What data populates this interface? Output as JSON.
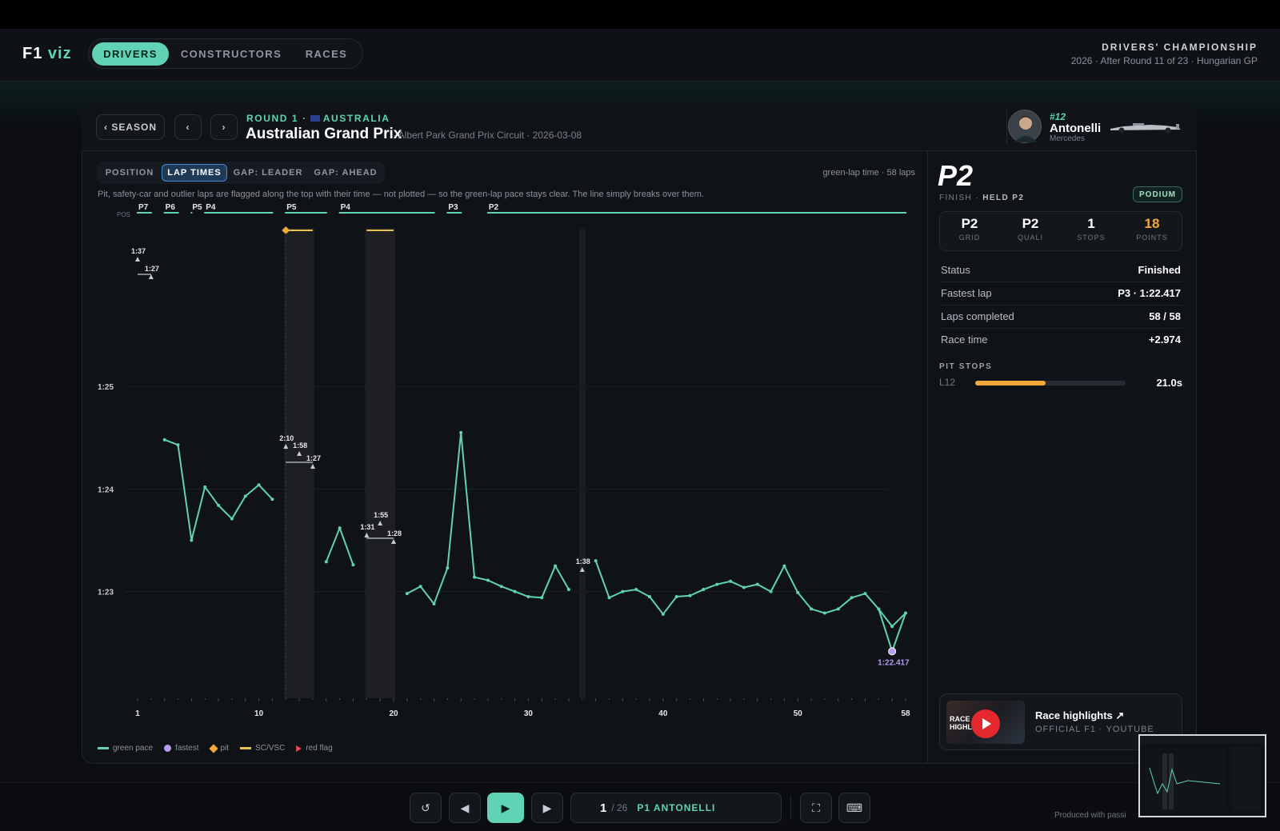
{
  "app": {
    "logo_a": "F1",
    "logo_b": "viz"
  },
  "nav": {
    "tabs": [
      "DRIVERS",
      "CONSTRUCTORS",
      "RACES"
    ],
    "active": "DRIVERS"
  },
  "championship": {
    "title": "DRIVERS' CHAMPIONSHIP",
    "subtitle": "2026 · After Round 11 of 23 · Hungarian GP"
  },
  "race": {
    "season_btn": "‹ SEASON",
    "prev": "‹",
    "next": "›",
    "round": "ROUND 1 ·",
    "country": "AUSTRALIA",
    "name": "Australian Grand Prix",
    "sub": "· Albert Park Grand Prix Circuit · 2026-03-08"
  },
  "driver": {
    "number": "#12",
    "name": "Antonelli",
    "team": "Mercedes"
  },
  "view_tabs": [
    "POSITION",
    "LAP TIMES",
    "GAP: LEADER",
    "GAP: AHEAD"
  ],
  "active_view": "LAP TIMES",
  "laps_info": "green-lap time · 58 laps",
  "note": "Pit, safety-car and outlier laps are flagged along the top with their time — not plotted — so the green-lap pace stays clear. The line simply breaks over them.",
  "legend": {
    "green": "green pace",
    "fastest": "fastest",
    "pit": "pit",
    "sc": "SC/VSC",
    "red": "red flag"
  },
  "result": {
    "position": "P2",
    "sub_a": "FINISH ·",
    "sub_b": "HELD P2",
    "badge": "PODIUM"
  },
  "stats": [
    {
      "value": "P2",
      "label": "GRID"
    },
    {
      "value": "P2",
      "label": "QUALI"
    },
    {
      "value": "1",
      "label": "STOPS"
    },
    {
      "value": "18",
      "label": "POINTS"
    }
  ],
  "points_color": "#f2a93b",
  "details": [
    {
      "k": "Status",
      "v": "Finished"
    },
    {
      "k": "Fastest lap",
      "v": "P3 · 1:22.417"
    },
    {
      "k": "Laps completed",
      "v": "58 / 58"
    },
    {
      "k": "Race time",
      "v": "+2.974"
    }
  ],
  "pit_stops": {
    "title": "PIT STOPS",
    "lap": "L12",
    "time": "21.0s",
    "bar_fraction": 0.47
  },
  "highlights": {
    "title": "Race highlights ↗",
    "sub": "OFFICIAL F1 · YOUTUBE",
    "thumb_text": "RACE HIGHLIGHTS"
  },
  "player": {
    "frame": "1",
    "total": "/ 26",
    "label": "P1 ANTONELLI"
  },
  "produced": "Produced with passi",
  "chart_data": {
    "type": "line",
    "xlabel": "",
    "ylabel": "",
    "x_ticks": [
      1,
      10,
      20,
      30,
      40,
      50,
      58
    ],
    "xlim": [
      1,
      58
    ],
    "y_ticks": [
      "1:25",
      "1:24",
      "1:23"
    ],
    "y_tick_seconds": [
      85,
      84,
      83
    ],
    "ylim_seconds": [
      82.1,
      86.0
    ],
    "grid": true,
    "pos_label": "POS",
    "positions": [
      {
        "label": "P7",
        "from": 1,
        "to": 2
      },
      {
        "label": "P6",
        "from": 3,
        "to": 4
      },
      {
        "label": "P5",
        "from": 5,
        "to": 5
      },
      {
        "label": "P4",
        "from": 6,
        "to": 11
      },
      {
        "label": "P5",
        "from": 12,
        "to": 15
      },
      {
        "label": "P4",
        "from": 16,
        "to": 23
      },
      {
        "label": "P3",
        "from": 24,
        "to": 25
      },
      {
        "label": "P2",
        "from": 27,
        "to": 58
      }
    ],
    "segments": [
      [
        [
          3,
          84.48
        ],
        [
          4,
          84.43
        ],
        [
          5,
          83.5
        ],
        [
          6,
          84.02
        ],
        [
          7,
          83.84
        ],
        [
          8,
          83.71
        ],
        [
          9,
          83.93
        ],
        [
          10,
          84.04
        ],
        [
          11,
          83.9
        ]
      ],
      [
        [
          15,
          83.29
        ],
        [
          16,
          83.62
        ],
        [
          17,
          83.26
        ]
      ],
      [
        [
          21,
          82.98
        ],
        [
          22,
          83.05
        ],
        [
          23,
          82.88
        ],
        [
          24,
          83.23
        ],
        [
          25,
          84.55
        ],
        [
          26,
          83.14
        ],
        [
          27,
          83.11
        ],
        [
          28,
          83.05
        ],
        [
          29,
          83.0
        ],
        [
          30,
          82.95
        ],
        [
          31,
          82.94
        ],
        [
          32,
          83.25
        ],
        [
          33,
          83.02
        ]
      ],
      [
        [
          35,
          83.3
        ],
        [
          36,
          82.94
        ],
        [
          37,
          83.0
        ],
        [
          38,
          83.02
        ],
        [
          39,
          82.95
        ],
        [
          40,
          82.78
        ],
        [
          41,
          82.95
        ],
        [
          42,
          82.96
        ],
        [
          43,
          83.02
        ],
        [
          44,
          83.07
        ],
        [
          45,
          83.1
        ],
        [
          46,
          83.04
        ],
        [
          47,
          83.07
        ],
        [
          48,
          83.0
        ],
        [
          49,
          83.25
        ],
        [
          50,
          82.99
        ],
        [
          51,
          82.83
        ],
        [
          52,
          82.79
        ],
        [
          53,
          82.83
        ],
        [
          54,
          82.94
        ],
        [
          55,
          82.98
        ],
        [
          56,
          82.83
        ],
        [
          57,
          82.66
        ],
        [
          58,
          82.79
        ]
      ]
    ],
    "fastest": {
      "lap": 57,
      "seconds": 82.417,
      "label": "1:22.417"
    },
    "flagged": [
      {
        "lap": 1,
        "label": "1:37"
      },
      {
        "lap": 2,
        "label": "1:27"
      },
      {
        "lap": 12,
        "label": "2:10"
      },
      {
        "lap": 13,
        "label": "1:58"
      },
      {
        "lap": 14,
        "label": "1:27"
      },
      {
        "lap": 18,
        "label": "1:31"
      },
      {
        "lap": 19,
        "label": "1:55"
      },
      {
        "lap": 20,
        "label": "1:28"
      },
      {
        "lap": 34,
        "label": "1:38"
      }
    ],
    "sc_periods": [
      [
        12,
        14
      ],
      [
        18,
        20
      ]
    ],
    "vsc_lines": [
      34
    ],
    "pit_laps": [
      12
    ]
  }
}
